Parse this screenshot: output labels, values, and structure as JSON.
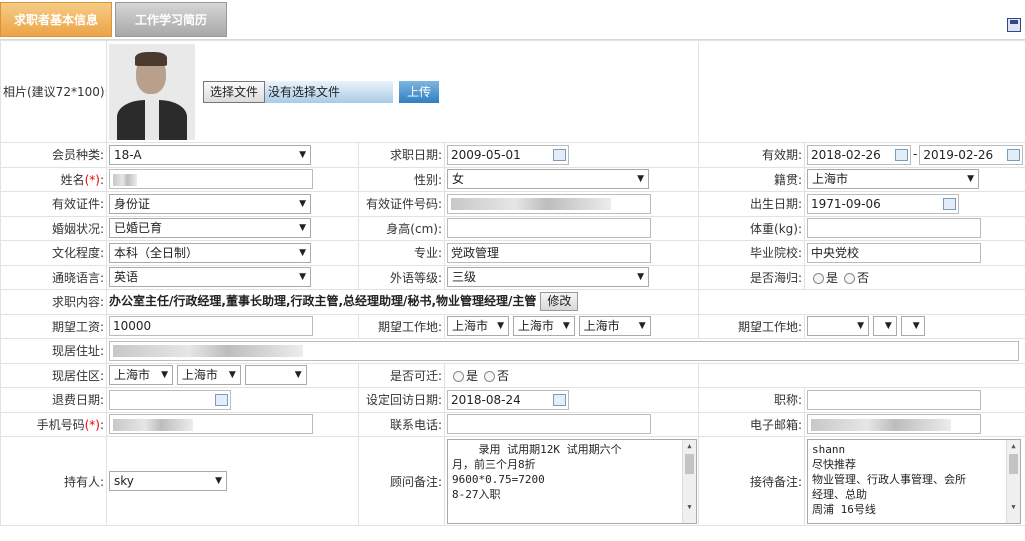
{
  "tabs": [
    {
      "label": "求职者基本信息"
    },
    {
      "label": "工作学习简历"
    }
  ],
  "photo": {
    "label": "相片(建议72*100):",
    "choose_btn": "选择文件",
    "no_file": "没有选择文件",
    "upload_btn": "上传"
  },
  "member_type": {
    "label": "会员种类:",
    "value": "18-A"
  },
  "apply_date": {
    "label": "求职日期:",
    "value": "2009-05-01"
  },
  "validity": {
    "label": "有效期:",
    "start": "2018-02-26",
    "sep": "-",
    "end": "2019-02-26"
  },
  "name": {
    "label": "姓名",
    "req": "(*)",
    "colon": ":"
  },
  "gender": {
    "label": "性别:",
    "value": "女"
  },
  "native": {
    "label": "籍贯:",
    "value": "上海市"
  },
  "id_type": {
    "label": "有效证件:",
    "value": "身份证"
  },
  "id_no": {
    "label": "有效证件号码:"
  },
  "birth": {
    "label": "出生日期:",
    "value": "1971-09-06"
  },
  "marital": {
    "label": "婚姻状况:",
    "value": "已婚已育"
  },
  "height": {
    "label": "身高(cm):"
  },
  "weight": {
    "label": "体重(kg):"
  },
  "education": {
    "label": "文化程度:",
    "value": "本科（全日制）"
  },
  "major": {
    "label": "专业:",
    "value": "党政管理"
  },
  "school": {
    "label": "毕业院校:",
    "value": "中央党校"
  },
  "language": {
    "label": "通晓语言:",
    "value": "英语"
  },
  "lang_level": {
    "label": "外语等级:",
    "value": "三级"
  },
  "returnee": {
    "label": "是否海归:",
    "yes": "是",
    "no": "否"
  },
  "job_intent": {
    "label": "求职内容:",
    "value": "办公室主任/行政经理,董事长助理,行政主管,总经理助理/秘书,物业管理经理/主管",
    "modify": "修改"
  },
  "salary": {
    "label": "期望工资:",
    "value": "10000"
  },
  "work_loc1": {
    "label": "期望工作地:",
    "v1": "上海市",
    "v2": "上海市",
    "v3": "上海市"
  },
  "work_loc2": {
    "label": "期望工作地:"
  },
  "address": {
    "label": "现居住址:"
  },
  "district": {
    "label": "现居住区:",
    "v1": "上海市",
    "v2": "上海市"
  },
  "relocate": {
    "label": "是否可迁:",
    "yes": "是",
    "no": "否"
  },
  "refund_date": {
    "label": "退费日期:"
  },
  "visit_date": {
    "label": "设定回访日期:",
    "value": "2018-08-24"
  },
  "title": {
    "label": "职称:"
  },
  "mobile": {
    "label": "手机号码",
    "req": "(*)",
    "colon": ":"
  },
  "phone": {
    "label": "联系电话:"
  },
  "email": {
    "label": "电子邮箱:"
  },
  "holder": {
    "label": "持有人:",
    "value": "sky"
  },
  "consult_note": {
    "label": "顾问备注:",
    "lines": [
      "    录用 试用期12K 试用期六个",
      "月，前三个月8折",
      "9600*0.75=7200",
      "8-27入职"
    ]
  },
  "reception_note": {
    "label": "接待备注:",
    "lines": [
      "shann",
      "尽快推荐",
      "物业管理、行政人事管理、会所",
      "经理、总助",
      "周浦 16号线"
    ]
  }
}
